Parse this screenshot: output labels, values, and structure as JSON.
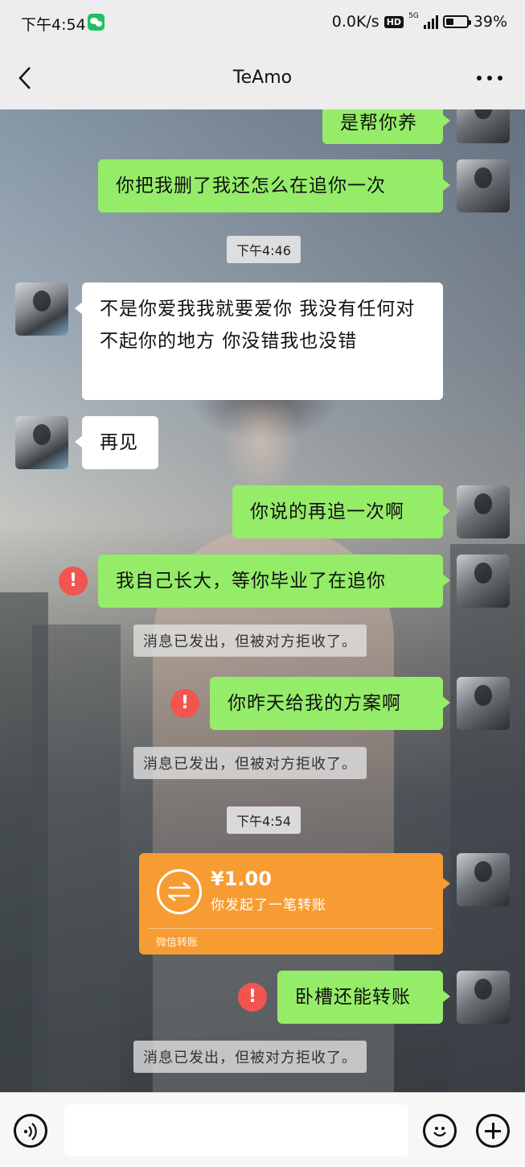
{
  "status_bar": {
    "time": "下午4:54",
    "network_speed": "0.0K/s",
    "hd_label": "HD",
    "signal_label": "5G",
    "battery": "39%"
  },
  "header": {
    "title": "TeAmo",
    "back_icon": "chevron-left-icon",
    "more_icon": "more-dots-icon"
  },
  "chat": {
    "messages": [
      {
        "side": "right",
        "text": "是帮你养"
      },
      {
        "side": "right",
        "text": "你把我删了我还怎么在追你一次"
      },
      {
        "type": "time",
        "text": "下午4:46"
      },
      {
        "side": "left",
        "text": "不是你爱我我就要爱你 我没有任何对不起你的地方 你没错我也没错"
      },
      {
        "side": "left",
        "text": "再见"
      },
      {
        "side": "right",
        "text": "你说的再追一次啊"
      },
      {
        "side": "right",
        "text": "我自己长大，等你毕业了在追你",
        "failed": true
      },
      {
        "type": "system",
        "text": "消息已发出，但被对方拒收了。"
      },
      {
        "side": "right",
        "text": "你昨天给我的方案啊",
        "failed": true
      },
      {
        "type": "system",
        "text": "消息已发出，但被对方拒收了。"
      },
      {
        "type": "time",
        "text": "下午4:54"
      },
      {
        "side": "right",
        "type": "transfer",
        "amount": "¥1.00",
        "desc": "你发起了一笔转账",
        "footer": "微信转账"
      },
      {
        "side": "right",
        "text": "卧槽还能转账",
        "failed": true
      },
      {
        "type": "system",
        "text": "消息已发出，但被对方拒收了。"
      }
    ],
    "failed_icon_text": "!"
  },
  "input_bar": {
    "value": "",
    "placeholder": "",
    "voice_icon": "voice-icon",
    "emoji_icon": "emoji-icon",
    "add_icon": "plus-icon"
  },
  "colors": {
    "sent_bubble": "#95ec69",
    "received_bubble": "#ffffff",
    "transfer_card": "#f79c32",
    "failed_badge": "#f2544f",
    "bar_background": "#ededed"
  }
}
